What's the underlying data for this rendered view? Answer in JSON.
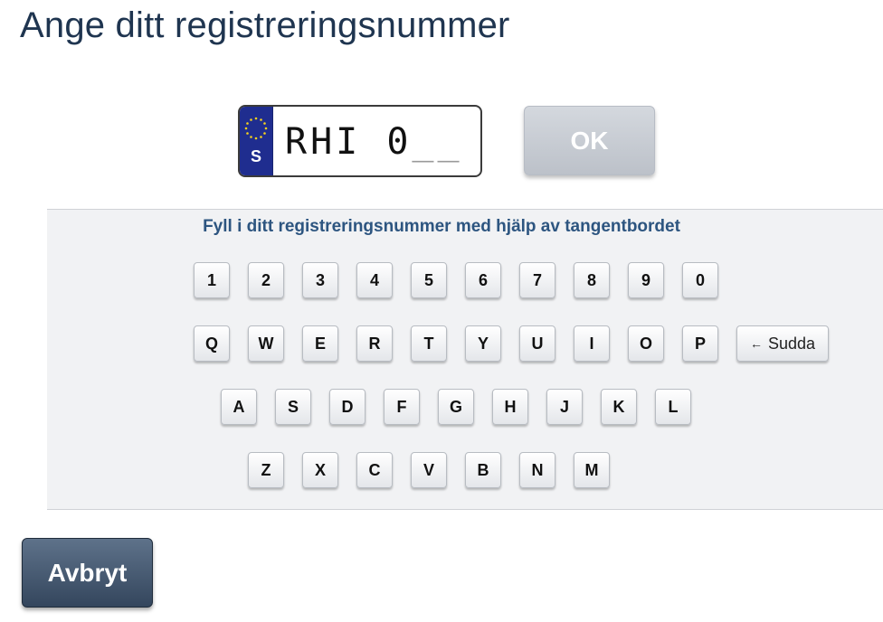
{
  "page": {
    "title": "Ange ditt registreringsnummer"
  },
  "plate": {
    "country_code": "S",
    "entered_text": "RHI 0",
    "remaining_placeholder": "__",
    "eu_icon": "eu-stars-icon"
  },
  "ok_button": {
    "label": "OK"
  },
  "keyboard": {
    "instruction": "Fyll i ditt registreringsnummer med hjälp av tangentbordet",
    "rows": [
      [
        "1",
        "2",
        "3",
        "4",
        "5",
        "6",
        "7",
        "8",
        "9",
        "0"
      ],
      [
        "Q",
        "W",
        "E",
        "R",
        "T",
        "Y",
        "U",
        "I",
        "O",
        "P"
      ],
      [
        "A",
        "S",
        "D",
        "F",
        "G",
        "H",
        "J",
        "K",
        "L"
      ],
      [
        "Z",
        "X",
        "C",
        "V",
        "B",
        "N",
        "M"
      ]
    ],
    "backspace": {
      "label": "Sudda",
      "icon": "left-arrow-icon"
    }
  },
  "cancel_button": {
    "label": "Avbryt"
  },
  "colors": {
    "title": "#1f3550",
    "instruction": "#2d5580",
    "eu_band": "#1f2d8f",
    "ok_button": "#c7cbd2",
    "cancel_button": "#46596f"
  }
}
